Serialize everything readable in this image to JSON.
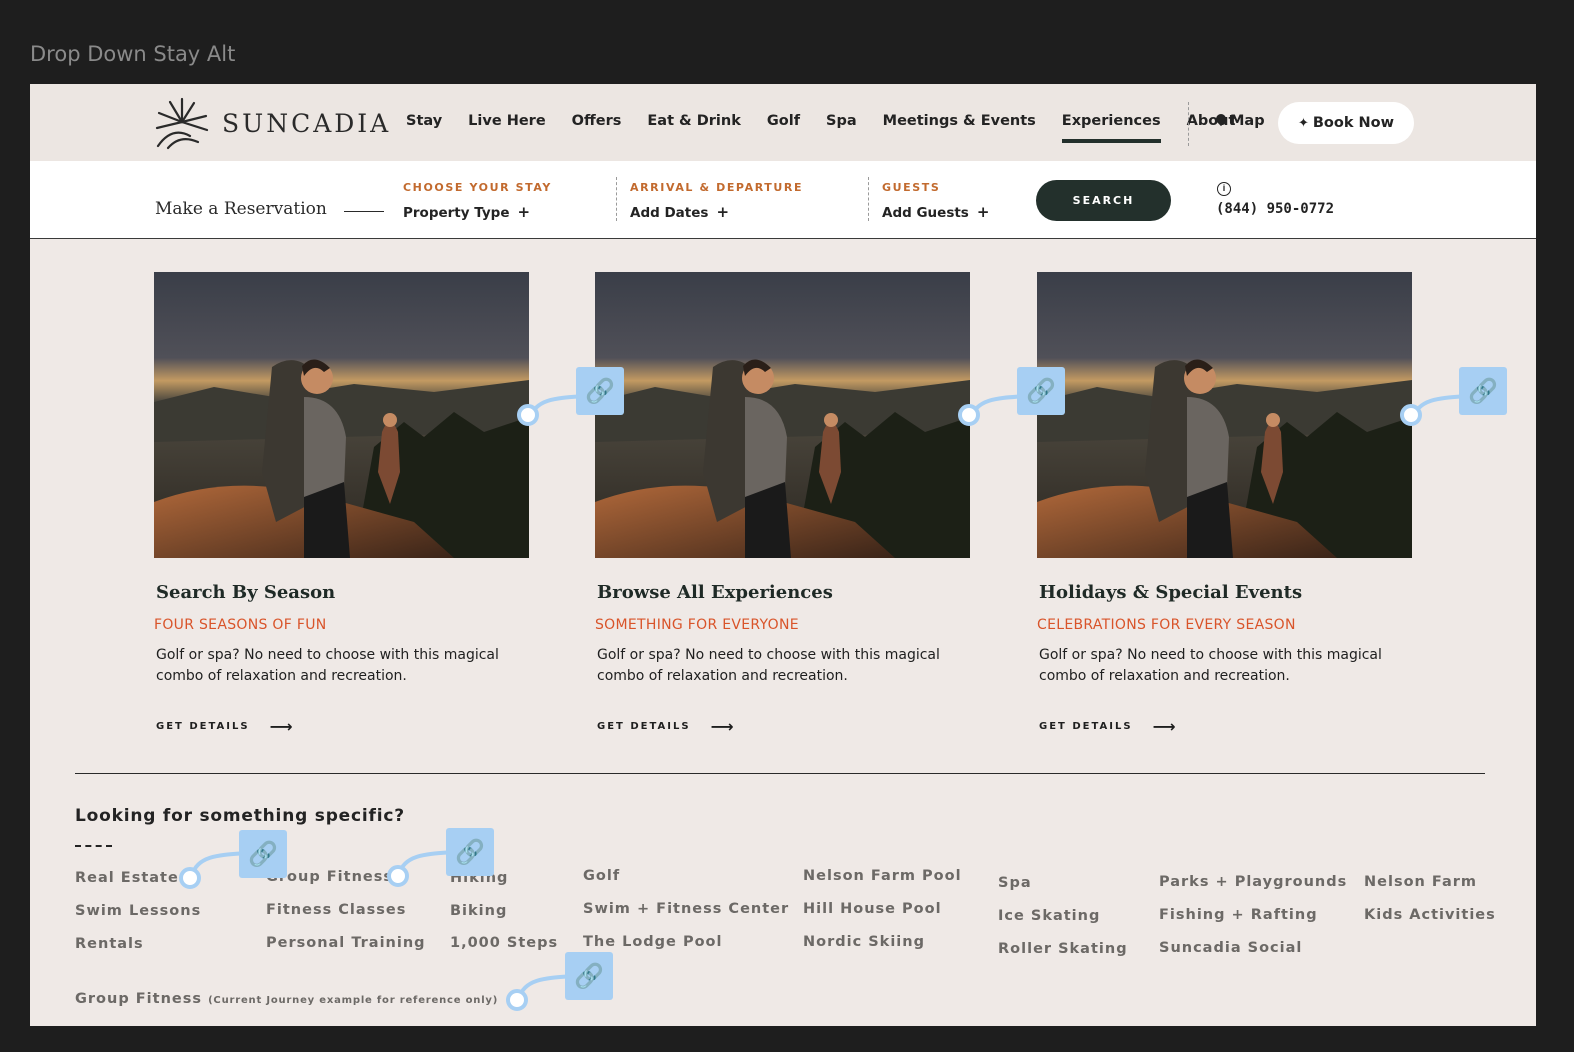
{
  "frame_label": "Drop Down Stay Alt",
  "brand": "SUNCADIA",
  "nav": {
    "items": [
      "Stay",
      "Live Here",
      "Offers",
      "Eat & Drink",
      "Golf",
      "Spa",
      "Meetings & Events",
      "Experiences",
      "About"
    ],
    "active": "Experiences",
    "map": "Map",
    "book_now": "Book Now"
  },
  "reservation": {
    "title": "Make a Reservation",
    "fields": [
      {
        "label": "CHOOSE YOUR STAY",
        "value": "Property Type"
      },
      {
        "label": "ARRIVAL & DEPARTURE",
        "value": "Add Dates"
      },
      {
        "label": "GUESTS",
        "value": "Add Guests"
      }
    ],
    "search": "SEARCH",
    "phone": "(844) 950-0772"
  },
  "cards": [
    {
      "title": "Search By Season",
      "subtitle": "FOUR SEASONS OF FUN",
      "description": "Golf or spa? No need to choose with this magical combo of relaxation and recreation.",
      "cta": "GET DETAILS"
    },
    {
      "title": "Browse All Experiences",
      "subtitle": "SOMETHING FOR EVERYONE",
      "description": "Golf or spa? No need to choose with this magical combo of relaxation and recreation.",
      "cta": "GET DETAILS"
    },
    {
      "title": "Holidays & Special Events",
      "subtitle": "CELEBRATIONS FOR EVERY SEASON",
      "description": "Golf or spa? No need to choose with this magical combo of relaxation and recreation.",
      "cta": "GET DETAILS"
    }
  ],
  "specific": {
    "heading": "Looking for something specific?",
    "columns": [
      [
        "Real Estate",
        "Swim Lessons",
        "Rentals"
      ],
      [
        "Group Fitness",
        "Fitness Classes",
        "Personal Training"
      ],
      [
        "Hiking",
        "Biking",
        "1,000 Steps"
      ],
      [
        "Golf",
        "Swim + Fitness Center",
        "The Lodge Pool"
      ],
      [
        "Nelson Farm Pool",
        "Hill House Pool",
        "Nordic Skiing"
      ],
      [
        "Spa",
        "Ice Skating",
        "Roller Skating"
      ],
      [
        "Parks + Playgrounds",
        "Fishing + Rafting",
        "Suncadia Social"
      ],
      [
        "Nelson Farm",
        "Kids Activities"
      ]
    ],
    "current": "Group Fitness",
    "current_note": "(Current Journey example for reference only)"
  },
  "colors": {
    "accent_orange": "#d9542a",
    "label_orange": "#c26a2e",
    "dark_green": "#23302c",
    "prototype_link": "#a7cff3"
  }
}
